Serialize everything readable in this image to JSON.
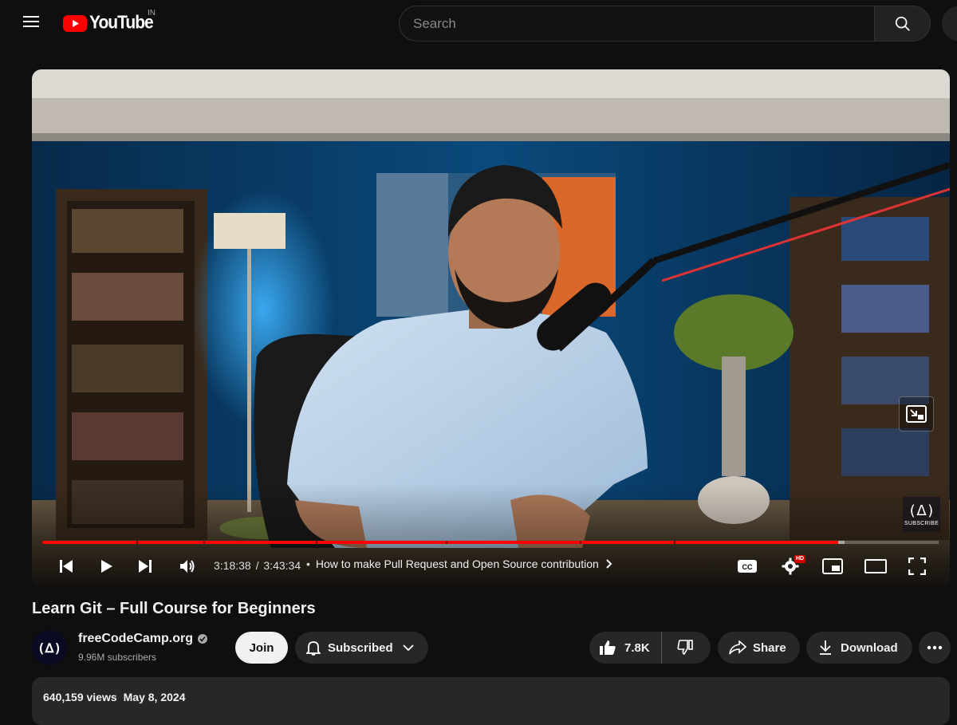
{
  "header": {
    "logo_text": "YouTube",
    "country_code": "IN",
    "search_placeholder": "Search"
  },
  "player": {
    "current_time": "3:18:38",
    "duration": "3:43:34",
    "time_separator": "/",
    "chapter_bullet": "•",
    "chapter_title": "How to make Pull Request and Open Source contribution",
    "played_fraction": 0.888,
    "loaded_fraction": 0.895,
    "chapter_marks": [
      0.105,
      0.18,
      0.305,
      0.45,
      0.6,
      0.705
    ],
    "settings_badge": "HD",
    "watermark_glyph": "(ᐃ)",
    "watermark_text": "SUBSCRIBE"
  },
  "video": {
    "title": "Learn Git – Full Course for Beginners"
  },
  "channel": {
    "name": "freeCodeCamp.org",
    "subscribers": "9.96M subscribers",
    "avatar_glyph": "(ᐃ)"
  },
  "actions": {
    "join_label": "Join",
    "subscribe_label": "Subscribed",
    "like_count": "7.8K",
    "share_label": "Share",
    "download_label": "Download"
  },
  "description": {
    "views": "640,159 views",
    "date": "May 8, 2024"
  },
  "colors": {
    "background": "#0f0f0f",
    "brand_red": "#ff0000",
    "pill_bg": "#272727"
  }
}
